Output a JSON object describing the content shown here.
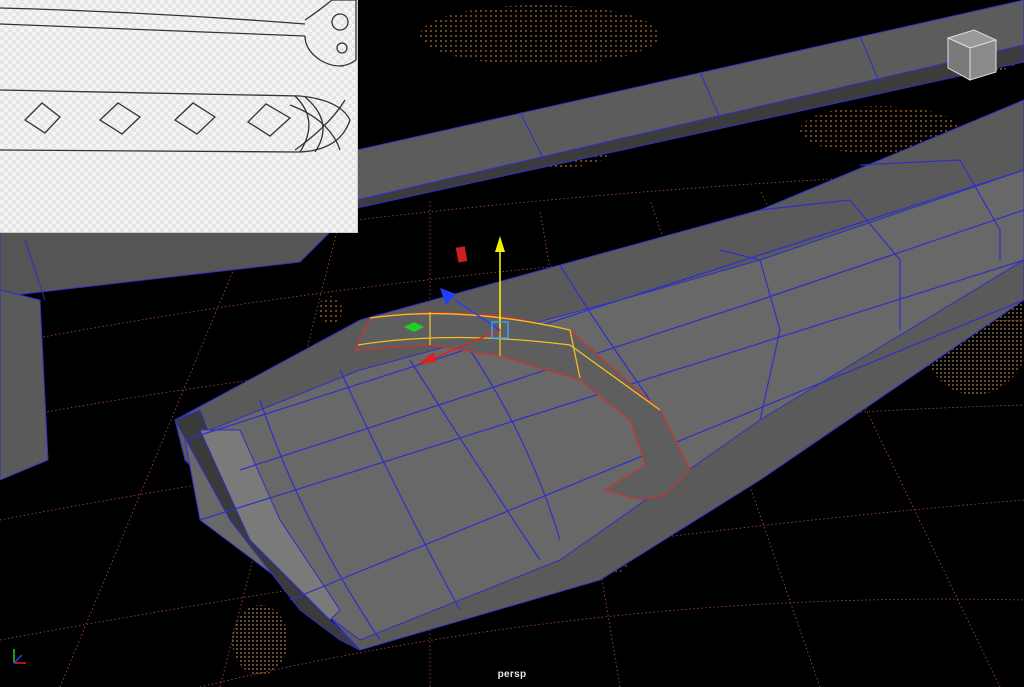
{
  "viewport": {
    "camera_label": "persp",
    "colors": {
      "background": "#000000",
      "grid": "#b04848",
      "mesh_fill": "#5a5a5a",
      "mesh_dark": "#3c3c3c",
      "mesh_edge": "#2f2fc8",
      "selection": "#f0c020",
      "selection_outline": "#cc3333",
      "manipulator_y": "#f0f000",
      "manipulator_x": "#e02020",
      "manipulator_z": "#2040ff",
      "manipulator_plane": "#20d020"
    },
    "icons": [
      "view-cube-icon",
      "axis-triad-icon",
      "move-manipulator-icon"
    ]
  },
  "reference_image": {
    "icons": [
      "sword-blade-drawing-icon",
      "handle-pattern-drawing-icon"
    ]
  }
}
